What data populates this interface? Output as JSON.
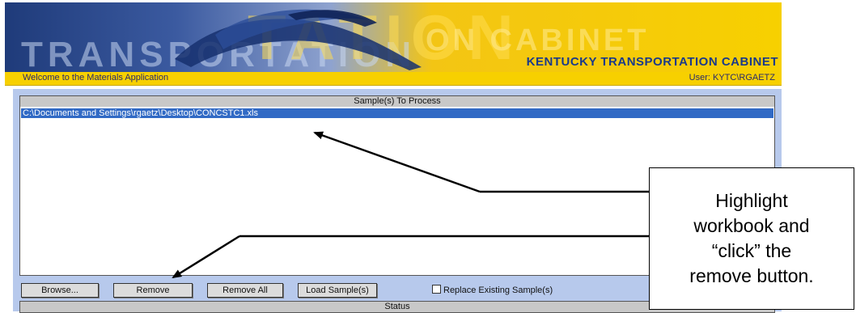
{
  "banner": {
    "background_word": "TATION",
    "background_word2": "TRANSPORTATION",
    "background_word3": "ON CABINET",
    "agency": "KENTUCKY TRANSPORTATION CABINET"
  },
  "strip": {
    "welcome": "Welcome to the Materials Application",
    "user": "User: KYTC\\RGAETZ"
  },
  "samples": {
    "header": "Sample(s) To Process",
    "items": [
      "C:\\Documents and Settings\\rgaetz\\Desktop\\CONCSTC1.xls"
    ]
  },
  "toolbar": {
    "browse": "Browse...",
    "remove": "Remove",
    "remove_all": "Remove All",
    "load_samples": "Load Sample(s)",
    "replace_label": "Replace Existing Sample(s)"
  },
  "status": {
    "header": "Status"
  },
  "callout": {
    "lines": [
      "Highlight",
      "workbook and",
      "“click” the",
      "remove button."
    ]
  },
  "colors": {
    "panel": "#b7c9ec",
    "selection": "#316ac5",
    "banner_yellow": "#f7d000",
    "banner_blue": "#1a3a8a"
  }
}
